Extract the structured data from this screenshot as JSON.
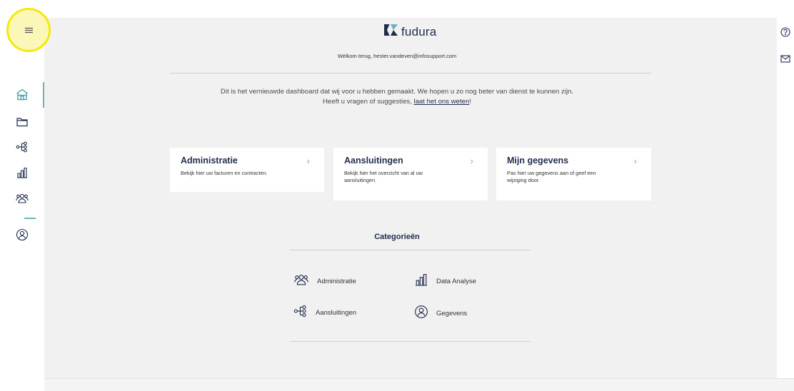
{
  "sidebar": {
    "menu_icon": "hamburger-icon",
    "icons": [
      "home-icon",
      "folder-icon",
      "network-icon",
      "bar-chart-icon",
      "users-icon",
      "user-icon"
    ]
  },
  "header": {
    "brand": "fudura",
    "welcome": "Welkom terug, hester.vandeven@infosupport.com"
  },
  "intro": {
    "text": "Dit is het vernieuwde dashboard dat wij voor u hebben gemaakt. We hopen u zo nog beter van dienst te kunnen zijn. Heeft u vragen of suggesties, ",
    "link": "laat het ons weten",
    "suffix": "!"
  },
  "cards": [
    {
      "title": "Administratie",
      "desc": "Bekijk hier uw facturen en contracten."
    },
    {
      "title": "Aansluitingen",
      "desc": "Bekijk hier het overzicht van al uw aansluitingen."
    },
    {
      "title": "Mijn gegevens",
      "desc": "Pas hier uw gegevens aan of geef een wijziging door."
    }
  ],
  "categories": {
    "title": "Categorieën",
    "items": [
      "Administratie",
      "Data Analyse",
      "Aansluitingen",
      "Gegevens"
    ]
  },
  "right_rail": {
    "icons": [
      "help-icon",
      "mail-icon"
    ]
  },
  "colors": {
    "accent": "#6fb3b8",
    "navy": "#1f2d4d",
    "highlight": "#f4e90f"
  }
}
